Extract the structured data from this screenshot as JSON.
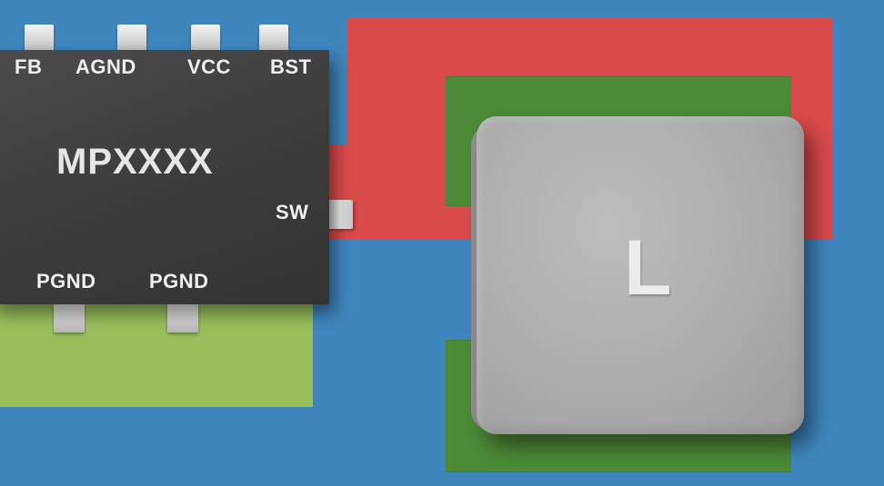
{
  "colors": {
    "board": "#3f86bd",
    "sw_copper": "#d94a4b",
    "inductor_pad": "#4c8a37",
    "pgnd_copper": "#98bf5c",
    "ic_body": "#3d3d3d",
    "inductor_body": "#a9a9a9"
  },
  "ic": {
    "part_name": "MPXXXX",
    "pins_top": [
      "FB",
      "AGND",
      "VCC",
      "BST"
    ],
    "pin_right": "SW",
    "pins_bottom": [
      "PGND",
      "PGND"
    ]
  },
  "inductor": {
    "label": "L"
  }
}
